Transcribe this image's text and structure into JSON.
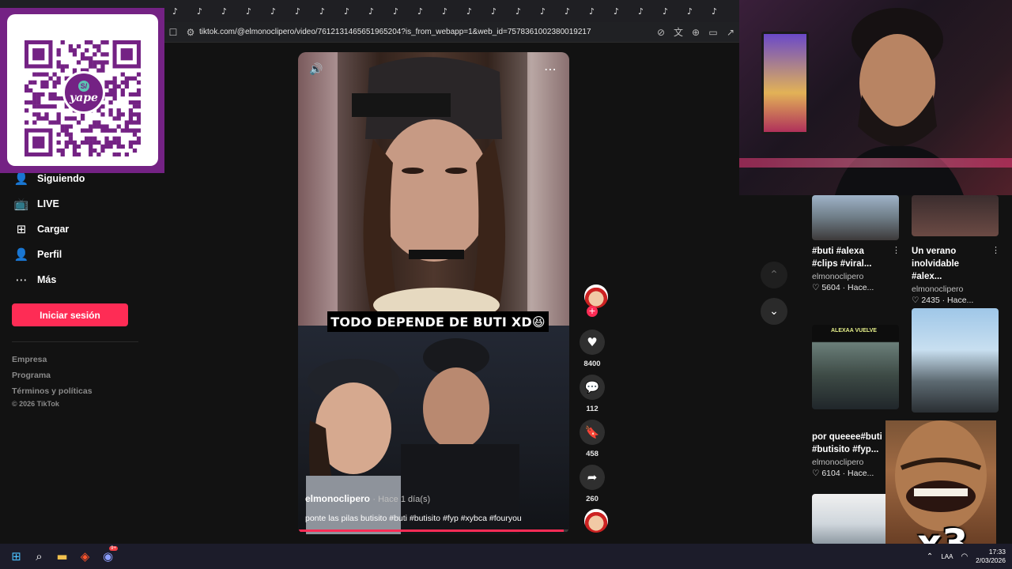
{
  "browser": {
    "url": "tiktok.com/@elmonoclipero/video/7612131465651965204?is_from_webapp=1&web_id=7578361002380019217",
    "tab_icon": "tiktok-icon"
  },
  "qr": {
    "brand": "yape",
    "currency": "S/"
  },
  "sidebar": {
    "items": [
      {
        "label": "Siguiendo",
        "icon": "following-icon"
      },
      {
        "label": "LIVE",
        "icon": "live-icon"
      },
      {
        "label": "Cargar",
        "icon": "upload-icon"
      },
      {
        "label": "Perfil",
        "icon": "profile-icon"
      },
      {
        "label": "Más",
        "icon": "more-icon"
      }
    ],
    "login_label": "Iniciar sesión",
    "footer_links": [
      "Empresa",
      "Programa",
      "Términos y políticas"
    ],
    "copyright": "© 2026 TikTok"
  },
  "video": {
    "caption_overlay": "TODO DEPENDE DE BUTI XD😆",
    "author": "elmonoclipero",
    "time": "· Hace 1 día(s)",
    "description": "ponte las pilas butisito #buti #butisito #fyp #xybca #fouryou",
    "progress": 0.98
  },
  "actions": {
    "likes": "8400",
    "comments": "112",
    "saves": "458",
    "shares": "260"
  },
  "related": [
    {
      "title": "#buti #alexa #clips #viral...",
      "author": "elmonoclipero",
      "views": "5604",
      "when": "Hace..."
    },
    {
      "title": "Un verano inolvidable #alex...",
      "author": "elmonoclipero",
      "views": "2435",
      "when": "Hace..."
    },
    {
      "title": "por queeee#buti #butisito #fyp...",
      "author": "elmonoclipero",
      "views": "6104",
      "when": "Hace..."
    }
  ],
  "related_thumb_text": "ALEXAA VUELVE",
  "meme": {
    "label": "x3"
  },
  "taskbar": {
    "time": "17:33",
    "date": "2/03/2026",
    "lang": "LAA",
    "discord_badge": "9+"
  },
  "colors": {
    "accent": "#fe2c55",
    "yape_purple": "#742284",
    "background": "#121212"
  }
}
